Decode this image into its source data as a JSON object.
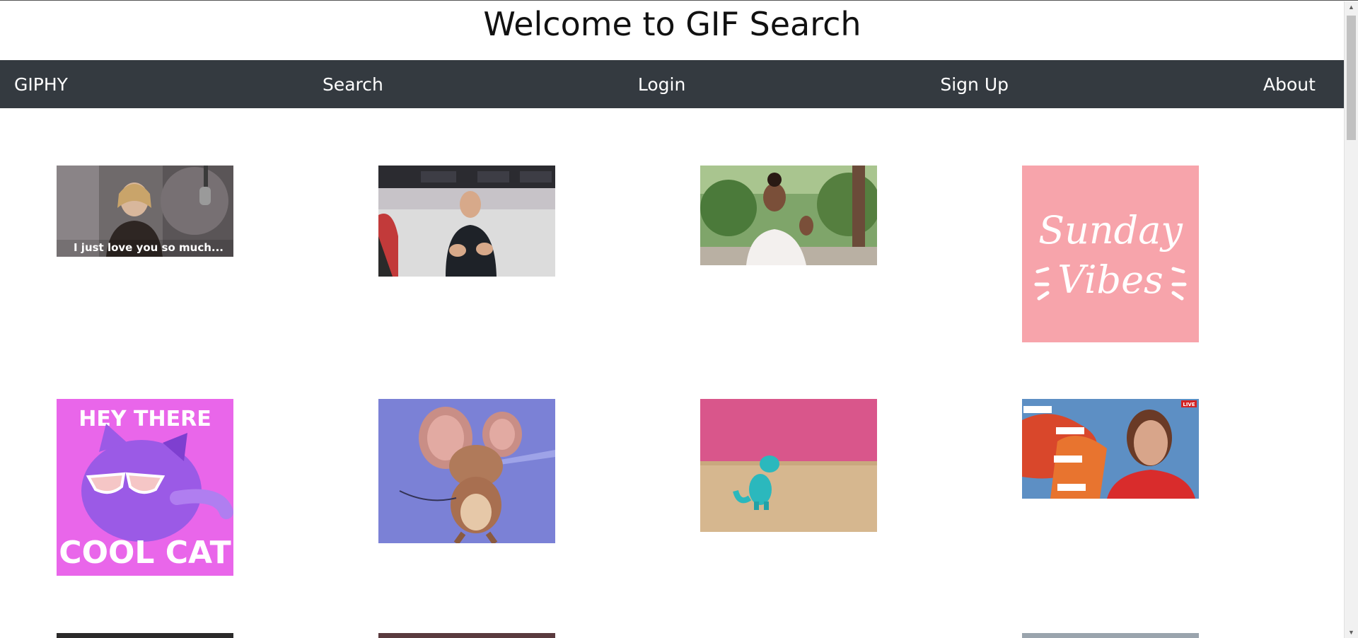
{
  "header": {
    "title": "Welcome to GIF Search"
  },
  "nav": {
    "brand": "GIPHY",
    "search": "Search",
    "login": "Login",
    "signup": "Sign Up",
    "about": "About"
  },
  "gifs": {
    "g1_caption": "I just love you so much...",
    "g4_line1": "Sunday",
    "g4_line2": "Vibes",
    "g5_line1": "HEY THERE",
    "g5_line2": "COOL CAT",
    "g8_live": "LIVE"
  },
  "colors": {
    "navbar": "#343a40",
    "nav_text": "#ffffff",
    "sunday_bg": "#f7a4ab",
    "coolcat_bg": "#e966ea",
    "jerry_bg": "#7b81d6"
  }
}
